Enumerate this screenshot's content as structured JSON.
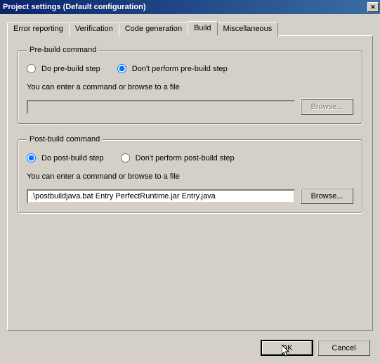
{
  "title": "Project settings (Default configuration)",
  "tabs": {
    "error_reporting": "Error reporting",
    "verification": "Verification",
    "code_generation": "Code generation",
    "build": "Build",
    "miscellaneous": "Miscellaneous"
  },
  "pre_build": {
    "legend": "Pre-build command",
    "radio_do": "Do pre-build step",
    "radio_dont": "Don't perform pre-build step",
    "hint": "You can enter a command or browse to a file",
    "input_value": "",
    "browse": "Browse..."
  },
  "post_build": {
    "legend": "Post-build command",
    "radio_do": "Do post-build step",
    "radio_dont": "Don't perform post-build step",
    "hint": "You can enter a command or browse to a file",
    "input_value": ".\\postbuildjava.bat Entry PerfectRuntime.jar Entry.java",
    "browse": "Browse..."
  },
  "buttons": {
    "ok": "OK",
    "cancel": "Cancel"
  }
}
